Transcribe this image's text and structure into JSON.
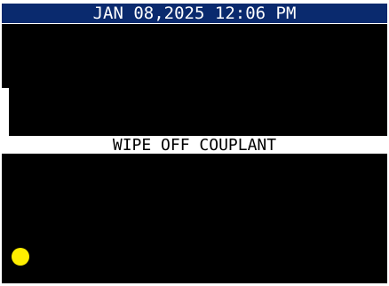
{
  "header": {
    "datetime": "JAN 08,2025 12:06 PM"
  },
  "message": {
    "text": "WIPE OFF COUPLANT"
  },
  "indicator": {
    "color": "#ffee00",
    "icon": "status-dot-icon"
  },
  "colors": {
    "title_bar": "#0a2a6e",
    "panel": "#000000",
    "background": "#ffffff"
  }
}
